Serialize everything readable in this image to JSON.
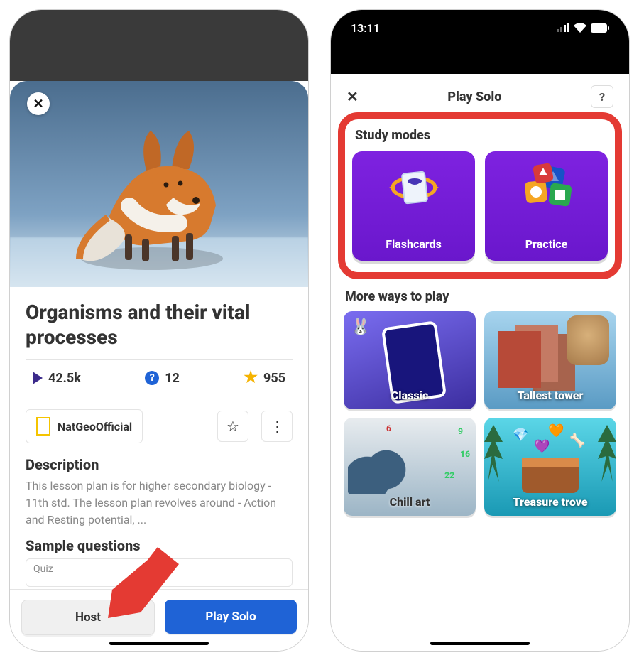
{
  "left": {
    "title": "Organisms and their vital processes",
    "stats": {
      "plays": "42.5k",
      "questions": "12",
      "favorites": "955"
    },
    "creator": "NatGeoOfficial",
    "description_heading": "Description",
    "description": "This lesson plan is for higher secondary biology - 11th std. The lesson plan revolves around - Action and Resting potential, ...",
    "sample_heading": "Sample questions",
    "quiz_label": "Quiz",
    "buttons": {
      "host": "Host",
      "play_solo": "Play Solo"
    }
  },
  "right": {
    "status_time": "13:11",
    "sheet_title": "Play Solo",
    "help_label": "?",
    "study_modes_heading": "Study modes",
    "modes": [
      {
        "label": "Flashcards"
      },
      {
        "label": "Practice"
      }
    ],
    "more_heading": "More ways to play",
    "games": [
      {
        "label": "Classic"
      },
      {
        "label": "Tallest tower"
      },
      {
        "label": "Chill art"
      },
      {
        "label": "Treasure trove"
      }
    ]
  }
}
